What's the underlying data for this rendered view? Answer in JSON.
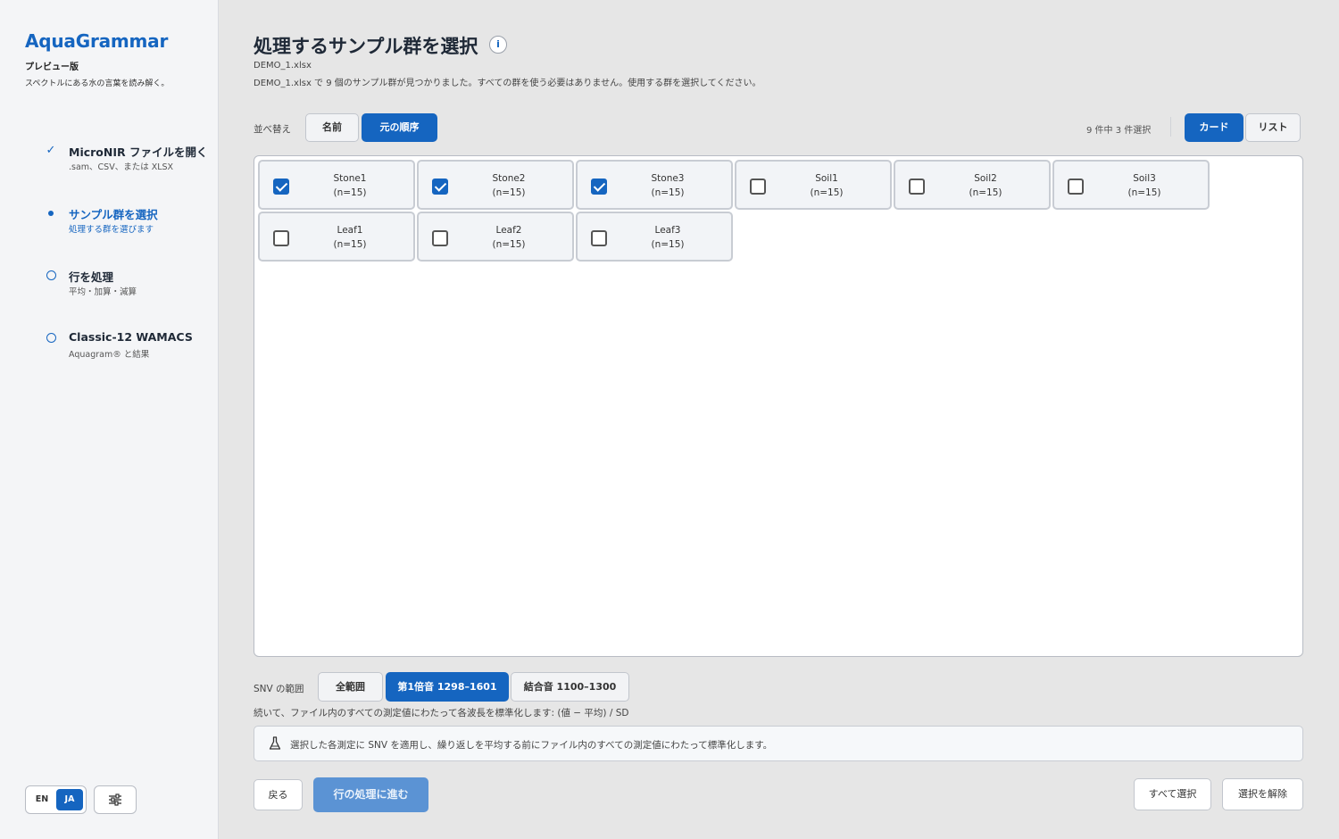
{
  "app": {
    "name": "AquaGrammar",
    "edition": "プレビュー版",
    "tagline": "スペクトルにある水の言葉を読み解く。"
  },
  "steps": [
    {
      "title": "MicroNIR ファイルを開く",
      "subtitle": ".sam、CSV、または XLSX",
      "state": "done"
    },
    {
      "title": "サンプル群を選択",
      "subtitle": "処理する群を選びます",
      "state": "active"
    },
    {
      "title": "行を処理",
      "subtitle": "平均・加算・減算",
      "state": "pending"
    },
    {
      "title": "Classic-12 WAMACS",
      "subtitle": "Aquagram® と結果",
      "state": "pending"
    }
  ],
  "language": {
    "en": "EN",
    "ja": "JA",
    "selected": "JA"
  },
  "page": {
    "title": "処理するサンプル群を選択",
    "file_name": "DEMO_1.xlsx",
    "description": "DEMO_1.xlsx で 9 個のサンプル群が見つかりました。すべての群を使う必要はありません。使用する群を選択してください。"
  },
  "sort": {
    "label": "並べ替え",
    "options": [
      "名前",
      "元の順序"
    ],
    "selected": "元の順序"
  },
  "selection_count": "9 件中 3 件選択",
  "view": {
    "options": [
      "カード",
      "リスト"
    ],
    "selected": "カード"
  },
  "groups": [
    {
      "name": "Stone1",
      "count": "(n=15)",
      "checked": true
    },
    {
      "name": "Stone2",
      "count": "(n=15)",
      "checked": true
    },
    {
      "name": "Stone3",
      "count": "(n=15)",
      "checked": true
    },
    {
      "name": "Soil1",
      "count": "(n=15)",
      "checked": false
    },
    {
      "name": "Soil2",
      "count": "(n=15)",
      "checked": false
    },
    {
      "name": "Soil3",
      "count": "(n=15)",
      "checked": false
    },
    {
      "name": "Leaf1",
      "count": "(n=15)",
      "checked": false
    },
    {
      "name": "Leaf2",
      "count": "(n=15)",
      "checked": false
    },
    {
      "name": "Leaf3",
      "count": "(n=15)",
      "checked": false
    }
  ],
  "snv": {
    "label": "SNV の範囲",
    "options": [
      "全範囲",
      "第1倍音 1298–1601",
      "結合音 1100–1300"
    ],
    "selected": "第1倍音 1298–1601",
    "description": "続いて、ファイル内のすべての測定値にわたって各波長を標準化します: (値 − 平均) / SD",
    "note": "選択した各測定に SNV を適用し、繰り返しを平均する前にファイル内のすべての測定値にわたって標準化します。"
  },
  "footer": {
    "back": "戻る",
    "next": "行の処理に進む",
    "select_all": "すべて選択",
    "clear_selection": "選択を解除"
  },
  "colors": {
    "accent": "#1565c0",
    "background": "#e6e6e6",
    "sidebar": "#f4f5f7"
  }
}
